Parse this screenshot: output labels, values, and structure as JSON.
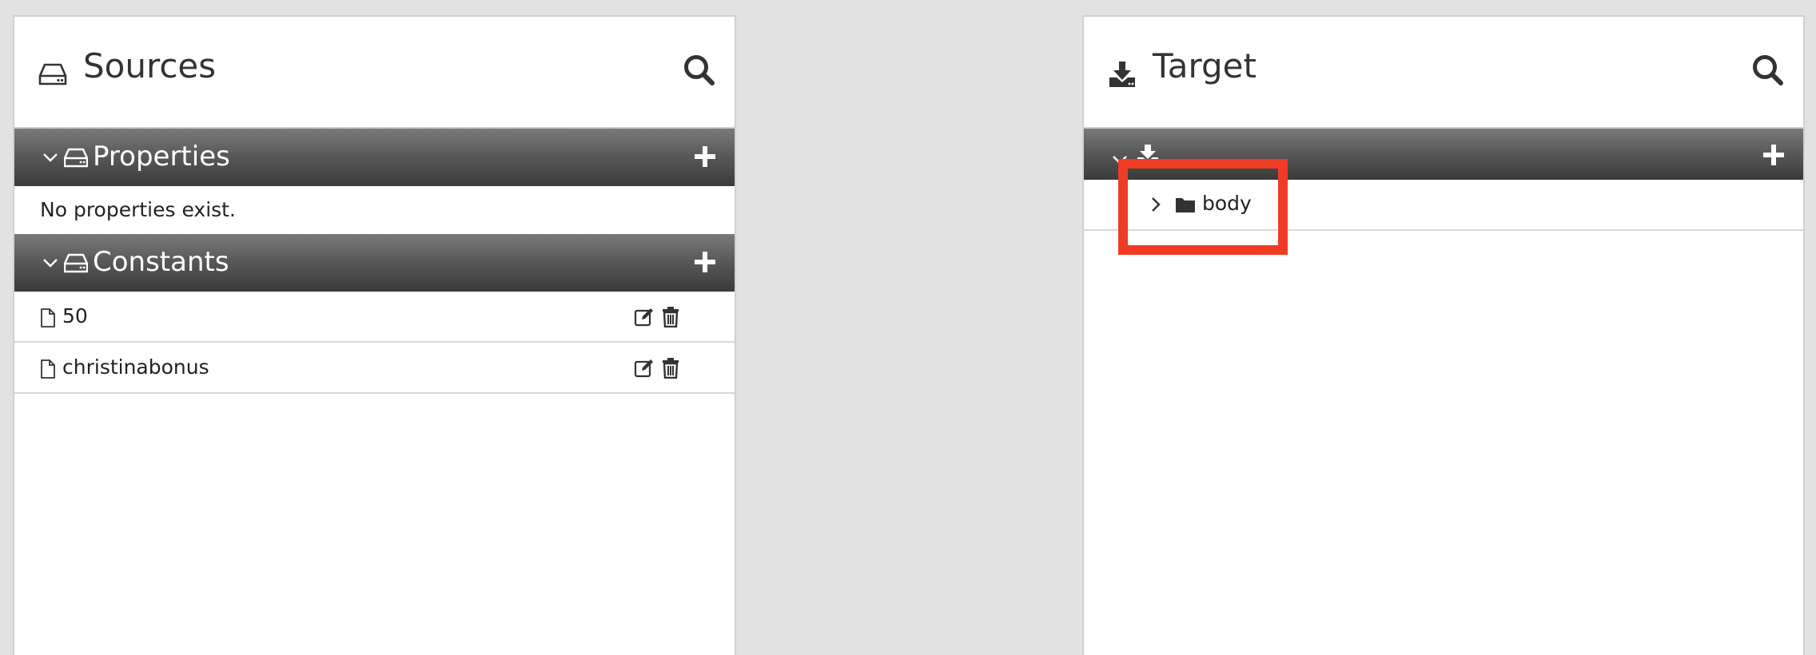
{
  "sources": {
    "title": "Sources",
    "icons": {
      "title": "hdd-icon",
      "search": "search-icon"
    },
    "sections": [
      {
        "label": "Properties",
        "empty_message": "No properties exist.",
        "items": []
      },
      {
        "label": "Constants",
        "items": [
          {
            "name": "50"
          },
          {
            "name": "christinabonus"
          }
        ]
      }
    ]
  },
  "target": {
    "title": "Target",
    "icons": {
      "title": "download-icon",
      "search": "search-icon"
    },
    "tree": [
      {
        "label": "body",
        "icon": "folder-icon",
        "expanded": false
      }
    ]
  },
  "colors": {
    "highlight": "#f03c24",
    "section_bar_top": "#7a7a7a",
    "section_bar_bottom": "#3a3a3a",
    "background": "#e2e2e2"
  }
}
